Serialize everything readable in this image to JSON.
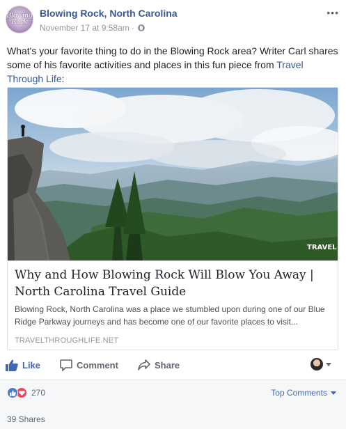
{
  "post": {
    "page_name": "Blowing Rock, North Carolina",
    "avatar_text": "Blowing Rock",
    "timestamp": "November 17 at 9:58am",
    "separator": "·",
    "privacy_icon": "globe-icon",
    "more_icon": "•••",
    "text": "What's your favorite thing to do in the Blowing Rock area? Writer Carl shares some of his favorite activities and places in this fun piece from ",
    "text_link": "Travel Through Life",
    "text_end": ":"
  },
  "link_card": {
    "image_watermark": "TRAVEL",
    "title": "Why and How Blowing Rock Will Blow You Away | North Carolina Travel Guide",
    "description": "Blowing Rock, North Carolina was a place we stumbled upon during one of our Blue Ridge Parkway journeys and has become one of our favorite places to visit...",
    "domain": "TRAVELTHROUGHLIFE.NET"
  },
  "actions": {
    "like_label": "Like",
    "comment_label": "Comment",
    "share_label": "Share"
  },
  "footer": {
    "reaction_count": "270",
    "top_comments_label": "Top Comments",
    "shares_label": "39 Shares"
  },
  "colors": {
    "link_blue": "#365899",
    "action_blue": "#4267b2",
    "meta_gray": "#90949c",
    "like_blue": "#4a76d4",
    "love_red": "#f2415a"
  }
}
